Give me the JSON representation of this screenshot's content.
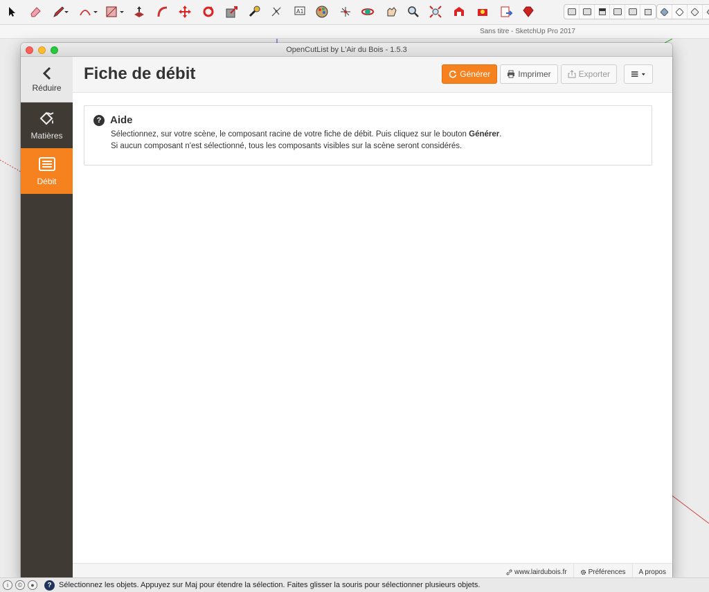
{
  "sketchup": {
    "window_title": "Sans titre - SketchUp Pro 2017",
    "status_message": "Sélectionnez les objets. Appuyez sur Maj pour étendre la sélection. Faites glisser la souris pour sélectionner plusieurs objets.",
    "tools": [
      "select-icon",
      "eraser-icon",
      "pencil-icon",
      "arc-icon",
      "rectangle-icon",
      "push-pull-icon",
      "follow-me-icon",
      "move-icon",
      "rotate-icon",
      "scale-icon",
      "tape-measure-icon",
      "axes-icon",
      "text-icon",
      "paint-bucket-icon",
      "section-plane-icon",
      "orbit-icon",
      "pan-icon",
      "zoom-icon",
      "zoom-extents-icon",
      "warehouse-icon",
      "extension-icon",
      "send-icon",
      "ruby-icon"
    ]
  },
  "ocl": {
    "window_title": "OpenCutList by L'Air du Bois - 1.5.3",
    "sidebar": {
      "collapse_label": "Réduire",
      "items": [
        {
          "label": "Matières",
          "icon": "materials-icon"
        },
        {
          "label": "Débit",
          "icon": "cutlist-icon"
        }
      ]
    },
    "header": {
      "title": "Fiche de débit",
      "generate_label": "Générer",
      "print_label": "Imprimer",
      "export_label": "Exporter"
    },
    "help": {
      "title": "Aide",
      "line1_prefix": "Sélectionnez, sur votre scène, le composant racine de votre fiche de débit. Puis cliquez sur le bouton ",
      "line1_bold": "Générer",
      "line1_suffix": ".",
      "line2": "Si aucun composant n'est sélectionné, tous les composants visibles sur la scène seront considérés."
    },
    "footer": {
      "website_label": "www.lairdubois.fr",
      "preferences_label": "Préférences",
      "about_label": "A propos"
    }
  },
  "colors": {
    "accent": "#f5811f",
    "sidebar_bg": "#3f3b34"
  }
}
